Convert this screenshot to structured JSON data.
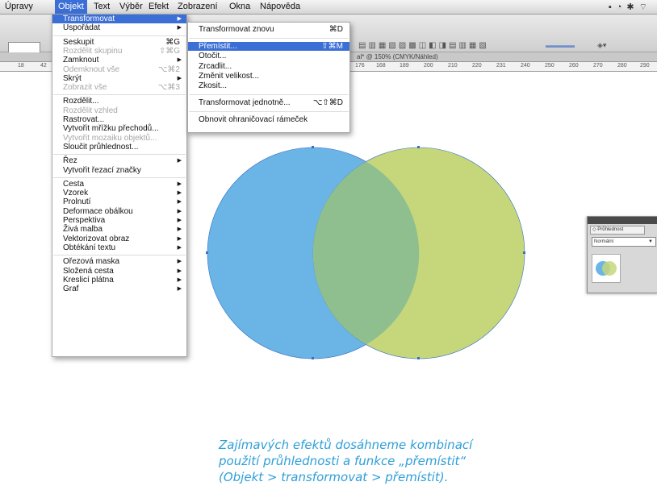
{
  "menubar": {
    "items": [
      "Úpravy",
      "Objekt",
      "Text",
      "Výběr",
      "Efekt",
      "Zobrazení",
      "Okna",
      "Nápověda"
    ],
    "active_index": 1
  },
  "document": {
    "title": "al* @ 150% (CMYK/Náhled)",
    "ruler_ticks": [
      "18",
      "42",
      "176",
      "168",
      "189",
      "200",
      "210",
      "220",
      "231",
      "240",
      "250",
      "260",
      "270",
      "280",
      "290"
    ]
  },
  "object_menu": {
    "items": [
      {
        "label": "Transformovat",
        "shortcut": "",
        "submenu": true,
        "state": "highlighted"
      },
      {
        "label": "Uspořádat",
        "shortcut": "",
        "submenu": true,
        "state": "normal"
      },
      {
        "sep": true
      },
      {
        "label": "Seskupit",
        "shortcut": "⌘G",
        "submenu": false,
        "state": "normal"
      },
      {
        "label": "Rozdělit skupinu",
        "shortcut": "⇧⌘G",
        "submenu": false,
        "state": "disabled"
      },
      {
        "label": "Zamknout",
        "shortcut": "",
        "submenu": true,
        "state": "normal"
      },
      {
        "label": "Odemknout vše",
        "shortcut": "⌥⌘2",
        "submenu": false,
        "state": "disabled"
      },
      {
        "label": "Skrýt",
        "shortcut": "",
        "submenu": true,
        "state": "normal"
      },
      {
        "label": "Zobrazit vše",
        "shortcut": "⌥⌘3",
        "submenu": false,
        "state": "disabled"
      },
      {
        "sep": true
      },
      {
        "label": "Rozdělit...",
        "shortcut": "",
        "submenu": false,
        "state": "normal"
      },
      {
        "label": "Rozdělit vzhled",
        "shortcut": "",
        "submenu": false,
        "state": "disabled"
      },
      {
        "label": "Rastrovat...",
        "shortcut": "",
        "submenu": false,
        "state": "normal"
      },
      {
        "label": "Vytvořit mřížku přechodů...",
        "shortcut": "",
        "submenu": false,
        "state": "normal"
      },
      {
        "label": "Vytvořit mozaiku objektů...",
        "shortcut": "",
        "submenu": false,
        "state": "disabled"
      },
      {
        "label": "Sloučit průhlednost...",
        "shortcut": "",
        "submenu": false,
        "state": "normal"
      },
      {
        "sep": true
      },
      {
        "label": "Řez",
        "shortcut": "",
        "submenu": true,
        "state": "normal"
      },
      {
        "label": "Vytvořit řezací značky",
        "shortcut": "",
        "submenu": false,
        "state": "normal"
      },
      {
        "sep": true
      },
      {
        "label": "Cesta",
        "shortcut": "",
        "submenu": true,
        "state": "normal"
      },
      {
        "label": "Vzorek",
        "shortcut": "",
        "submenu": true,
        "state": "normal"
      },
      {
        "label": "Prolnutí",
        "shortcut": "",
        "submenu": true,
        "state": "normal"
      },
      {
        "label": "Deformace obálkou",
        "shortcut": "",
        "submenu": true,
        "state": "normal"
      },
      {
        "label": "Perspektiva",
        "shortcut": "",
        "submenu": true,
        "state": "normal"
      },
      {
        "label": "Živá malba",
        "shortcut": "",
        "submenu": true,
        "state": "normal"
      },
      {
        "label": "Vektorizovat obraz",
        "shortcut": "",
        "submenu": true,
        "state": "normal"
      },
      {
        "label": "Obtékání textu",
        "shortcut": "",
        "submenu": true,
        "state": "normal"
      },
      {
        "sep": true
      },
      {
        "label": "Ořezová maska",
        "shortcut": "",
        "submenu": true,
        "state": "normal"
      },
      {
        "label": "Složená cesta",
        "shortcut": "",
        "submenu": true,
        "state": "normal"
      },
      {
        "label": "Kreslicí plátna",
        "shortcut": "",
        "submenu": true,
        "state": "normal"
      },
      {
        "label": "Graf",
        "shortcut": "",
        "submenu": true,
        "state": "normal"
      }
    ]
  },
  "transform_menu": {
    "items": [
      {
        "label": "Transformovat znovu",
        "shortcut": "⌘D",
        "state": "normal"
      },
      {
        "sep": true
      },
      {
        "label": "Přemístit...",
        "shortcut": "⇧⌘M",
        "state": "highlighted"
      },
      {
        "label": "Otočit...",
        "shortcut": "",
        "state": "normal"
      },
      {
        "label": "Zrcadlit...",
        "shortcut": "",
        "state": "normal"
      },
      {
        "label": "Změnit velikost...",
        "shortcut": "",
        "state": "normal"
      },
      {
        "label": "Zkosit...",
        "shortcut": "",
        "state": "normal"
      },
      {
        "sep": true
      },
      {
        "label": "Transformovat jednotně...",
        "shortcut": "⌥⇧⌘D",
        "state": "normal"
      },
      {
        "sep": true
      },
      {
        "label": "Obnovit ohraničovací rámeček",
        "shortcut": "",
        "state": "normal"
      }
    ]
  },
  "transparency_panel": {
    "tab_label": "◇ Průhlednost",
    "blend_mode": "Normální"
  },
  "artwork": {
    "left_circle_color": "#6ab4e6",
    "right_circle_color": "#c6d77b",
    "overlap_color": "#8fbf8f",
    "anchor_color": "#3a6fc4"
  },
  "caption": {
    "lines": [
      "Zajímavých efektů dosáhneme kombinací",
      "použití průhlednosti a funkce „přemístit“",
      "(Objekt > transformovat > přemístit)."
    ],
    "color": "#2e9fd8"
  },
  "accent": "#3b6fd6"
}
